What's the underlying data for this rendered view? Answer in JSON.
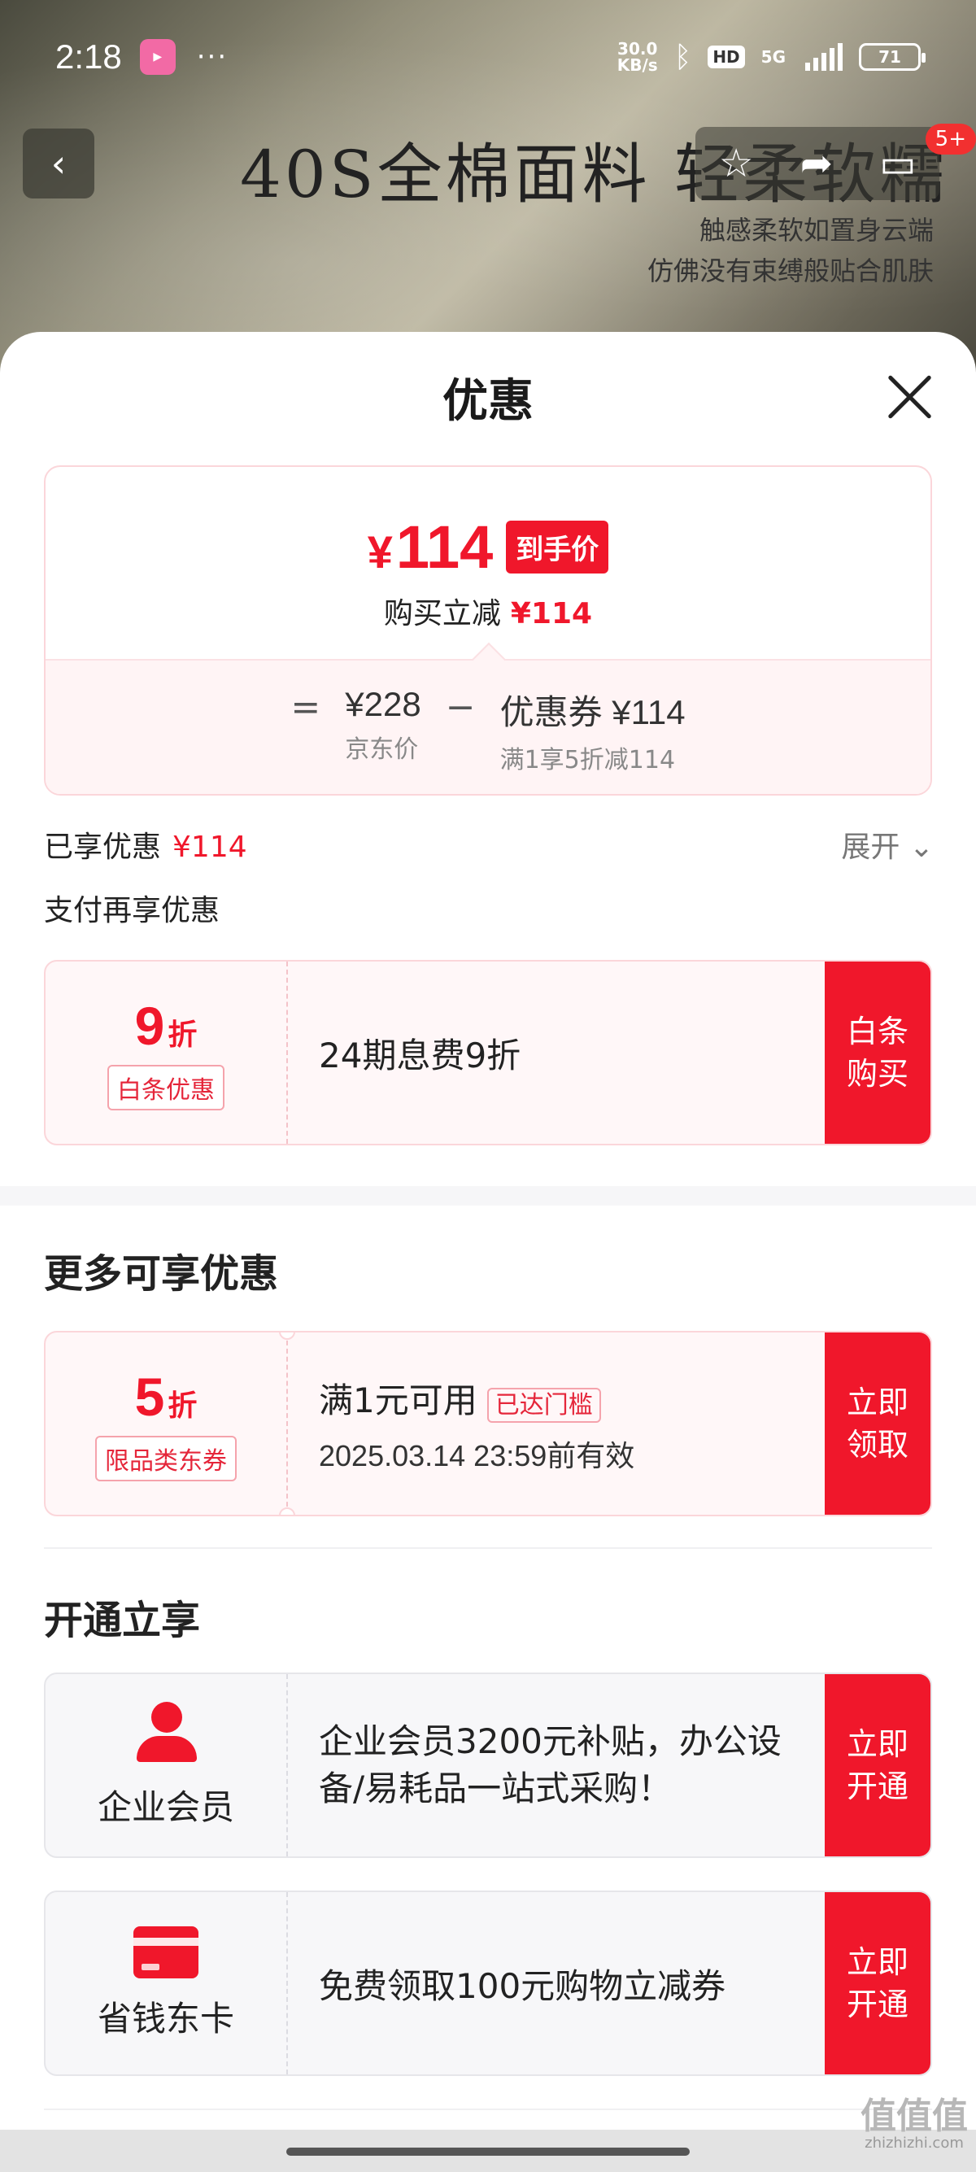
{
  "status": {
    "time": "2:18",
    "app_badge": "bilibili",
    "more": "···",
    "net_speed_value": "30.0",
    "net_speed_unit": "KB/s",
    "hd": "HD",
    "network": "5G",
    "battery": "71"
  },
  "banner": {
    "title": "40S全棉面料  轻柔软糯",
    "sub_line1": "触感柔软如置身云端",
    "sub_line2": "仿佛没有束缚般贴合肌肤",
    "cart_count": "5+"
  },
  "sheet": {
    "title": "优惠"
  },
  "price_card": {
    "currency": "¥",
    "final_price": "114",
    "final_tag": "到手价",
    "instant_reduce_label": "购买立减",
    "instant_reduce_value": "¥114",
    "equals": "=",
    "jd_price": "¥228",
    "jd_price_label": "京东价",
    "minus": "−",
    "coupon_value": "优惠券 ¥114",
    "coupon_desc": "满1享5折减114"
  },
  "enjoyed": {
    "label": "已享优惠",
    "value": "¥114",
    "expand": "展开"
  },
  "pay_more": "支付再享优惠",
  "baitiao": {
    "discount": "9",
    "unit": "折",
    "chip": "白条优惠",
    "desc": "24期息费9折",
    "button": "白条购买"
  },
  "more_section": {
    "title": "更多可享优惠",
    "coupon": {
      "discount": "5",
      "unit": "折",
      "chip": "限品类东券",
      "condition": "满1元可用",
      "badge": "已达门槛",
      "expiry": "2025.03.14 23:59前有效",
      "button": "立即领取"
    }
  },
  "open_section": {
    "title": "开通立享",
    "items": [
      {
        "label": "企业会员",
        "icon": "member-icon",
        "desc": "企业会员3200元补贴，办公设备/易耗品一站式采购！",
        "button": "立即开通"
      },
      {
        "label": "省钱东卡",
        "icon": "card-icon",
        "desc": "免费领取100元购物立减券",
        "button": "立即开通"
      }
    ]
  },
  "watermark": {
    "main": "值值值",
    "sub": "zhizhizhi.com"
  },
  "colors": {
    "accent": "#f0172b",
    "chip_border": "#f5a3ac"
  }
}
